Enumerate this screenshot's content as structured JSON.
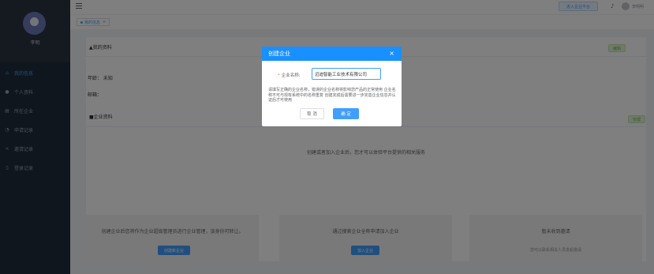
{
  "sidebar": {
    "username": "李明",
    "items": [
      {
        "label": "我的信息",
        "icon": "home-icon",
        "glyph": "⌂"
      },
      {
        "label": "个人资料",
        "icon": "user-icon",
        "glyph": "●"
      },
      {
        "label": "所在企业",
        "icon": "company-icon",
        "glyph": "▤"
      },
      {
        "label": "申请记录",
        "icon": "record-icon",
        "glyph": "◔"
      },
      {
        "label": "邀请记录",
        "icon": "share-icon",
        "glyph": "<"
      },
      {
        "label": "登录记录",
        "icon": "device-icon",
        "glyph": "▯"
      }
    ]
  },
  "topbar": {
    "enter_platform": "进入企业平台",
    "bell_glyph": "♪",
    "user_name": "李明明"
  },
  "tags": {
    "current": "我的信息",
    "close_glyph": "×"
  },
  "profile": {
    "section_title": "▲我的资料",
    "edit_label": "编辑",
    "age": "年龄：  未知",
    "email": "邮箱："
  },
  "company": {
    "section_title": "■企业资料",
    "manage_label": "管理",
    "prompt": "创建或者加入企业后，您才可以体验平台提供的相关服务",
    "boxes": [
      {
        "text": "创建企业后您将作为企业超级管理员进行企业管理，该身份可转让。",
        "button": "创建新企业"
      },
      {
        "text": "通过搜索企业全称申请加入企业",
        "button": "加入企业"
      },
      {
        "text": "暂未收到邀请",
        "sub": "您可以联系相关人员发起邀请"
      }
    ]
  },
  "dialog": {
    "title": "创建企业",
    "close_glyph": "×",
    "required_mark": "*",
    "name_label": "企业名称:",
    "name_value": "迈迪智能工业技术有限公司",
    "notice": "请填写正确的企业名称，错误的企业名称将影响您产品的正常使用 企业名称不可与现有系统中的名称重复 创建完成后需要进一步完善企业信息并认证后才可使用",
    "cancel": "取 消",
    "ok": "确 定"
  }
}
